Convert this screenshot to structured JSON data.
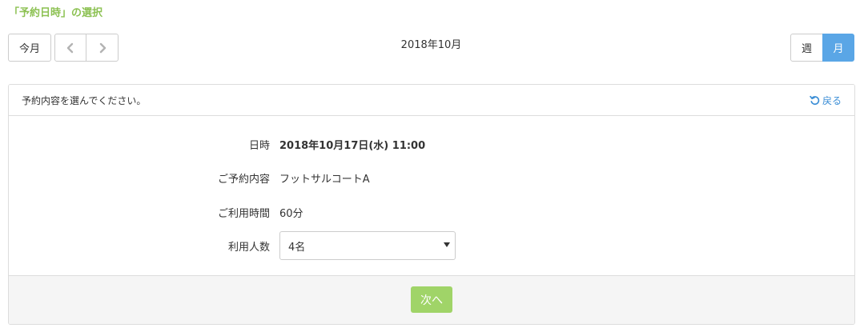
{
  "section": {
    "title": "「予約日時」の選択"
  },
  "calendar": {
    "today_label": "今月",
    "prev_icon": "chevron-left-icon",
    "next_icon": "chevron-right-icon",
    "current": "2018年10月",
    "view_week_label": "週",
    "view_month_label": "月",
    "active_view": "month"
  },
  "panel": {
    "message": "予約内容を選んでください。",
    "back_label": "戻る",
    "back_icon": "undo-icon",
    "rows": [
      {
        "label": "日時",
        "value": "2018年10月17日(水) 11:00"
      },
      {
        "label": "ご予約内容",
        "value": "フットサルコートA"
      },
      {
        "label": "ご利用時間",
        "value": "60分"
      },
      {
        "label": "利用人数",
        "selected": "4名"
      }
    ],
    "next_label": "次へ"
  },
  "colors": {
    "accent_green": "#8cc152",
    "button_green": "#a0d468",
    "active_blue": "#5aa6e6",
    "link_blue": "#3b8ed6"
  }
}
